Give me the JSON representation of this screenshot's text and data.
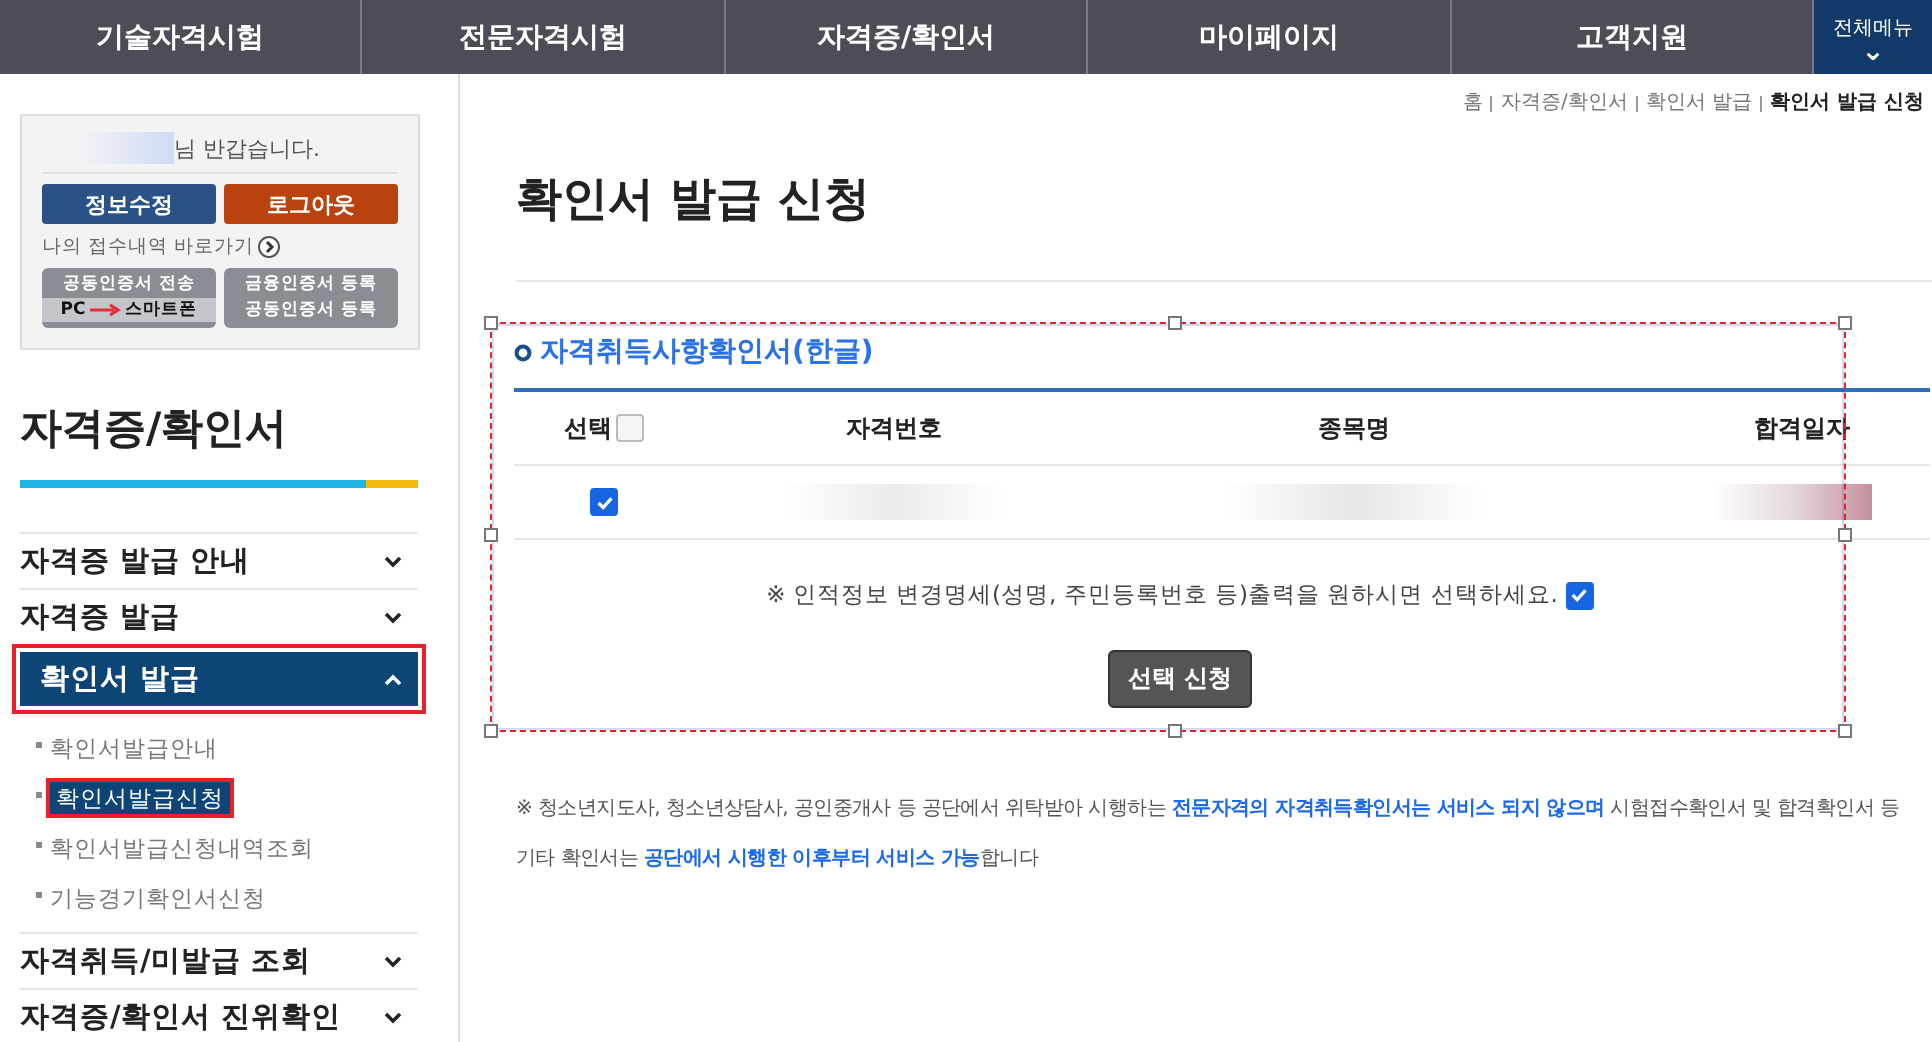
{
  "top_nav": {
    "items": [
      {
        "label": "기술자격시험",
        "selected": false
      },
      {
        "label": "전문자격시험",
        "selected": false
      },
      {
        "label": "자격증/확인서",
        "selected": false
      },
      {
        "label": "마이페이지",
        "selected": false
      },
      {
        "label": "고객지원",
        "selected": false
      }
    ],
    "all_menu": {
      "label": "전체메뉴",
      "icon": "⌄"
    }
  },
  "login_box": {
    "greeting": "님 반갑습니다.",
    "buttons": [
      {
        "label": "정보수정",
        "kind": "primary"
      },
      {
        "label": "로그아웃",
        "kind": "danger"
      }
    ],
    "shortcut": "나의 접수내역 바로가기",
    "cert_buttons": [
      {
        "kind": "split",
        "top": "공동인증서 전송",
        "bottom_left": "PC",
        "bottom_right": "스마트폰"
      },
      {
        "kind": "double",
        "top": "금융인증서 등록",
        "bottom": "공동인증서 등록"
      }
    ]
  },
  "sidebar": {
    "title": "자격증/확인서",
    "items": [
      {
        "label": "자격증 발급 안내",
        "expanded": false,
        "highlighted": false
      },
      {
        "label": "자격증 발급",
        "expanded": false,
        "highlighted": false
      },
      {
        "label": "확인서 발급",
        "expanded": true,
        "highlighted": true,
        "children": [
          {
            "label": "확인서발급안내",
            "selected": false,
            "highlighted": false
          },
          {
            "label": "확인서발급신청",
            "selected": true,
            "highlighted": true
          },
          {
            "label": "확인서발급신청내역조회",
            "selected": false,
            "highlighted": false
          },
          {
            "label": "기능경기확인서신청",
            "selected": false,
            "highlighted": false
          }
        ]
      },
      {
        "label": "자격취득/미발급 조회",
        "expanded": false,
        "highlighted": false
      },
      {
        "label": "자격증/확인서 진위확인",
        "expanded": false,
        "highlighted": false
      }
    ]
  },
  "breadcrumb": [
    "홈",
    "자격증/확인서",
    "확인서 발급",
    "확인서 발급 신청"
  ],
  "page_title": "확인서 발급 신청",
  "panel": {
    "highlighted": true,
    "section_title": "자격취득사항확인서(한글)",
    "table": {
      "select_all": {
        "label": "선택",
        "checked": false
      },
      "columns": [
        "자격번호",
        "종목명",
        "합격일자"
      ],
      "rows": [
        {
          "checked": true
        }
      ]
    },
    "option": {
      "text": "※ 인적정보 변경명세(성명, 주민등록번호 등)출력을 원하시면 선택하세요.",
      "checked": true
    },
    "submit": "선택 신청"
  },
  "notice": "※ 청소년지도사, 청소년상담사, 공인중개사 등 공단에서 위탁받아 시행하는 **전문자격의 자격취득확인서는 서비스 되지 않으며** 시험접수확인서 및 합격확인서 등 기타 확인서는 **공단에서 시행한 이후부터 서비스 가능**합니다"
}
